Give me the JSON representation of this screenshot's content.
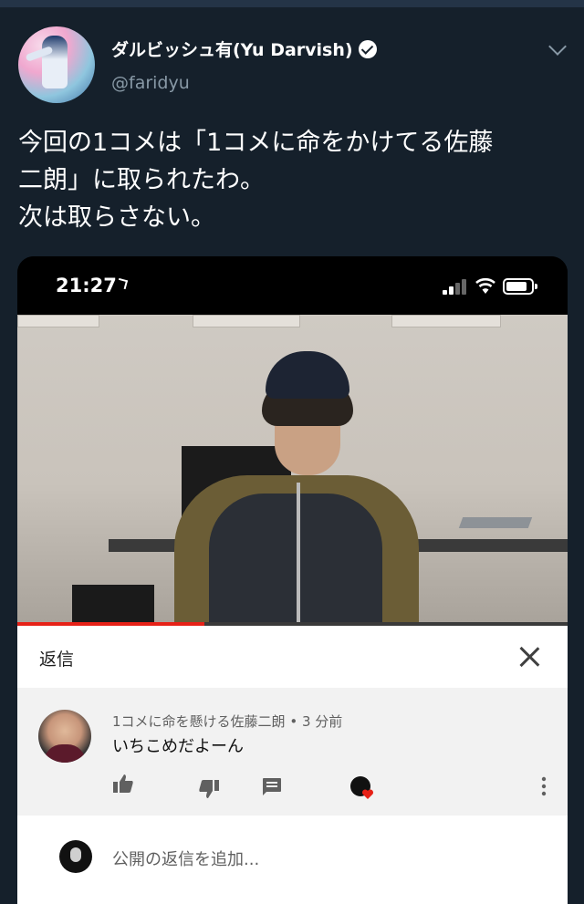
{
  "tweet": {
    "author_name": "ダルビッシュ有(Yu Darvish)",
    "handle": "@faridyu",
    "text": "今回の1コメは「1コメに命をかけてる佐藤\n二朗」に取られたわ。\n次は取らさない。"
  },
  "phone": {
    "time": "21:27"
  },
  "video": {
    "progress_fraction": 0.34
  },
  "reply_panel": {
    "title": "返信",
    "comment": {
      "author": "1コメに命を懸ける佐藤二朗",
      "time": "3 分前",
      "separator": " • ",
      "text": "いちこめだよーん"
    },
    "add_reply_placeholder": "公開の返信を追加..."
  },
  "icons": [
    "verified-icon",
    "chevron-down-icon",
    "location-arrow-icon",
    "signal-icon",
    "wifi-icon",
    "battery-icon",
    "close-icon",
    "thumbs-up-icon",
    "thumbs-down-icon",
    "reply-icon",
    "creator-heart-icon",
    "more-vert-icon"
  ],
  "colors": {
    "background": "#15202b",
    "secondary_text": "#8899a6",
    "progress_red": "#e62117",
    "heart_red": "#e62117"
  }
}
